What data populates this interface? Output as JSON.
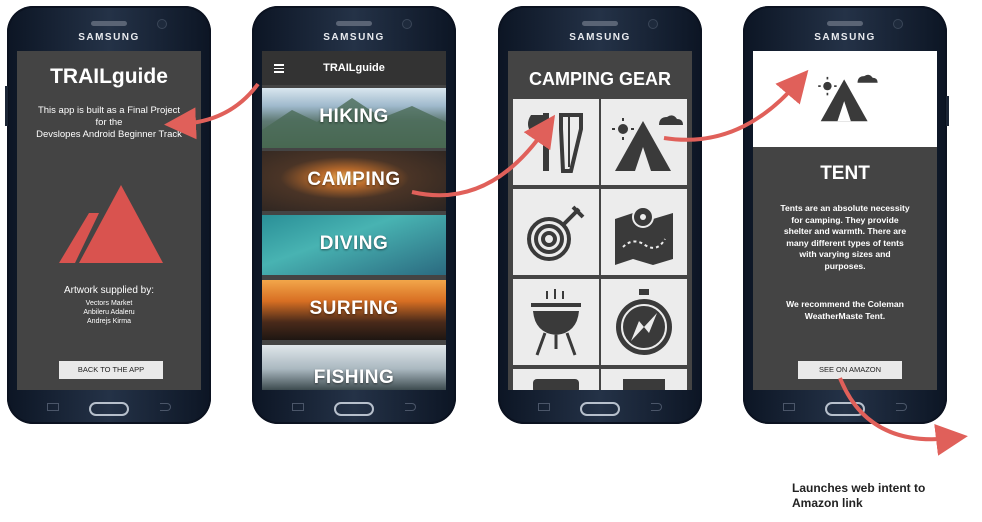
{
  "device_brand": "SAMSUNG",
  "screen_about": {
    "title": "TRAILguide",
    "description": "This app is built as a Final Project\nfor the\nDevslopes Android Beginner Track",
    "artwork_heading": "Artwork supplied by:",
    "artists": [
      "Vectors Market",
      "Anbileru Adaleru",
      "Andrejs Kirma"
    ],
    "back_button": "BACK TO THE APP",
    "logo_color": "#d9534f"
  },
  "screen_categories": {
    "app_title": "TRAILguide",
    "menu_icon": "hamburger-menu-icon",
    "categories": [
      "HIKING",
      "CAMPING",
      "DIVING",
      "SURFING",
      "FISHING"
    ]
  },
  "screen_gear": {
    "title": "CAMPING GEAR",
    "tiles": [
      "axe-saw-icon",
      "tent-icon",
      "rope-icon",
      "map-icon",
      "grill-icon",
      "compass-icon",
      "sleeping-bag-icon",
      "lantern-icon"
    ]
  },
  "screen_detail": {
    "name": "TENT",
    "description": "Tents are an absolute necessity\nfor camping. They provide\nshelter and warmth. There are\nmany different types of tents\nwith varying sizes and\npurposes.",
    "recommendation": "We recommend the Coleman\nWeatherMaste Tent.",
    "amazon_button": "SEE ON AMAZON"
  },
  "caption": "Launches web intent to\nAmazon link",
  "colors": {
    "arrow": "#e0605a",
    "screen_bg": "#444444",
    "tile_bg": "#ececec",
    "icon": "#3a3a3a"
  }
}
